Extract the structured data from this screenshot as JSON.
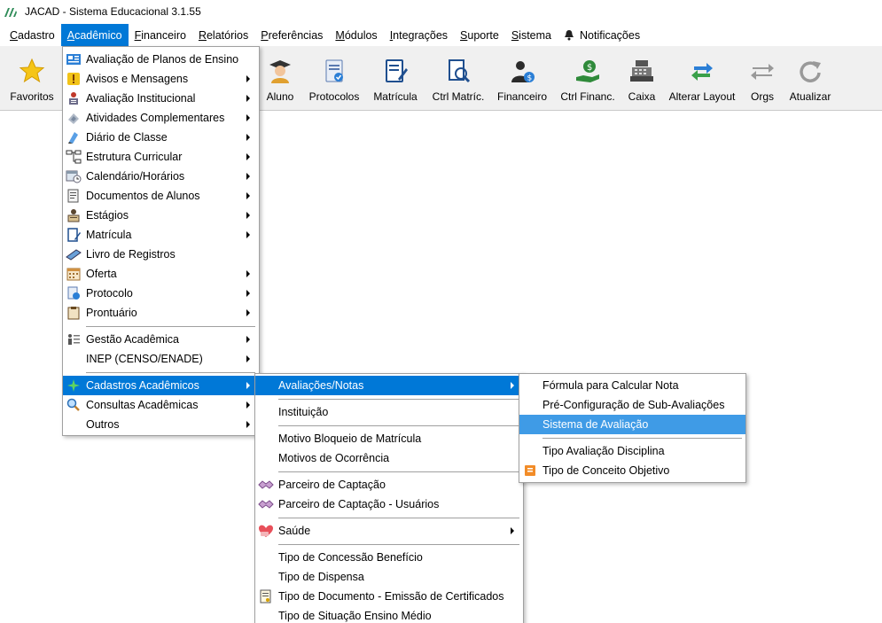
{
  "window": {
    "title": "JACAD - Sistema Educacional 3.1.55"
  },
  "menubar": {
    "items": [
      {
        "label": "Cadastro",
        "u": "C",
        "rest": "adastro"
      },
      {
        "label": "Acadêmico",
        "u": "A",
        "rest": "cadêmico"
      },
      {
        "label": "Financeiro",
        "u": "F",
        "rest": "inanceiro"
      },
      {
        "label": "Relatórios",
        "u": "R",
        "rest": "elatórios"
      },
      {
        "label": "Preferências",
        "u": "P",
        "rest": "referências"
      },
      {
        "label": "Módulos",
        "u": "M",
        "rest": "ódulos"
      },
      {
        "label": "Integrações",
        "u": "I",
        "rest": "ntegrações"
      },
      {
        "label": "Suporte",
        "u": "S",
        "rest": "uporte"
      },
      {
        "label": "Sistema",
        "u": "S",
        "rest": "istema"
      },
      {
        "label": "Notificações"
      }
    ]
  },
  "toolbar": {
    "buttons": [
      {
        "label": "Favoritos"
      },
      {
        "label": "Aluno"
      },
      {
        "label": "Protocolos"
      },
      {
        "label": "Matrícula"
      },
      {
        "label": "Ctrl Matríc."
      },
      {
        "label": "Financeiro"
      },
      {
        "label": "Ctrl Financ."
      },
      {
        "label": "Caixa"
      },
      {
        "label": "Alterar Layout"
      },
      {
        "label": "Orgs"
      },
      {
        "label": "Atualizar"
      }
    ]
  },
  "academico_menu": {
    "items": [
      {
        "label": "Avaliação de Planos de Ensino"
      },
      {
        "label": "Avisos e Mensagens"
      },
      {
        "label": "Avaliação Institucional"
      },
      {
        "label": "Atividades Complementares"
      },
      {
        "label": "Diário de Classe"
      },
      {
        "label": "Estrutura Curricular"
      },
      {
        "label": "Calendário/Horários"
      },
      {
        "label": "Documentos de Alunos"
      },
      {
        "label": "Estágios"
      },
      {
        "label": "Matrícula"
      },
      {
        "label": "Livro de Registros"
      },
      {
        "label": "Oferta"
      },
      {
        "label": "Protocolo"
      },
      {
        "label": "Prontuário"
      },
      {
        "label": "Gestão Acadêmica"
      },
      {
        "label": "INEP (CENSO/ENADE)"
      },
      {
        "label": "Cadastros Acadêmicos"
      },
      {
        "label": "Consultas Acadêmicas"
      },
      {
        "label": "Outros"
      }
    ]
  },
  "cadastros_menu": {
    "items": [
      {
        "label": "Avaliações/Notas"
      },
      {
        "label": "Instituição"
      },
      {
        "label": "Motivo Bloqueio de Matrícula"
      },
      {
        "label": "Motivos de Ocorrência"
      },
      {
        "label": "Parceiro de Captação"
      },
      {
        "label": "Parceiro de Captação - Usuários"
      },
      {
        "label": "Saúde"
      },
      {
        "label": "Tipo de Concessão Benefício"
      },
      {
        "label": "Tipo de Dispensa"
      },
      {
        "label": "Tipo de Documento - Emissão de Certificados"
      },
      {
        "label": "Tipo de Situação Ensino Médio"
      }
    ]
  },
  "avaliacoes_menu": {
    "items": [
      {
        "label": "Fórmula para Calcular Nota"
      },
      {
        "label": "Pré-Configuração de Sub-Avaliações"
      },
      {
        "label": "Sistema de Avaliação"
      },
      {
        "label": "Tipo Avaliação Disciplina"
      },
      {
        "label": "Tipo de Conceito Objetivo"
      }
    ]
  },
  "colors": {
    "accent": "#0078d7",
    "hover": "#3f9be6",
    "toolbar_bg": "#f0f0f0"
  }
}
